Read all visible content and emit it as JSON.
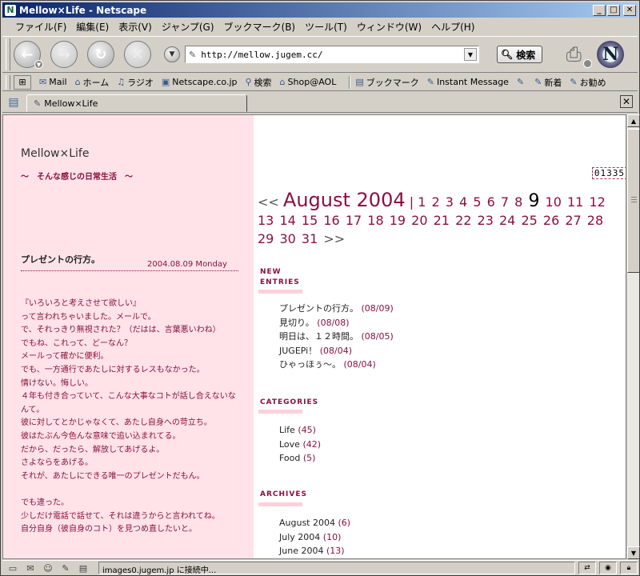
{
  "window": {
    "title": "Mellow×Life - Netscape"
  },
  "menu": [
    "ファイル(F)",
    "編集(E)",
    "表示(V)",
    "ジャンプ(G)",
    "ブックマーク(B)",
    "ツール(T)",
    "ウィンドウ(W)",
    "ヘルプ(H)"
  ],
  "nav": {
    "url": "http://mellow.jugem.cc/",
    "search_label": "検索"
  },
  "personal_bar": [
    {
      "label": "Mail",
      "icon": "mail-icon"
    },
    {
      "label": "ホーム",
      "icon": "home-icon"
    },
    {
      "label": "ラジオ",
      "icon": "headphones-icon"
    },
    {
      "label": "Netscape.co.jp",
      "icon": "my-icon"
    },
    {
      "label": "検索",
      "icon": "search-icon"
    },
    {
      "label": "Shop@AOL",
      "icon": "shop-icon"
    },
    {
      "label": "ブックマーク",
      "icon": "bookmark-icon"
    },
    {
      "label": "Instant Message",
      "icon": "im-icon"
    },
    {
      "label": "",
      "icon": "link-icon"
    },
    {
      "label": "新着",
      "icon": "link-icon"
    },
    {
      "label": "お勧め",
      "icon": "link-icon"
    }
  ],
  "tab": {
    "label": "Mellow×Life"
  },
  "blog": {
    "title": "Mellow×Life",
    "subtitle": "〜　そんな感じの日常生活　〜",
    "counter": "01335"
  },
  "post": {
    "title": "プレゼントの行方。",
    "date": "2004.08.09 Monday",
    "lines": [
      "『いろいろと考えさせて欲しい』",
      "って言われちゃいました。メールで。",
      "で、それっきり無視された？（だはは、言葉悪いわね）",
      "でもね、これって、どーなん？",
      "メールって確かに便利。",
      "でも、一方通行であたしに対するレスもなかった。",
      "情けない。悔しい。",
      "４年も付き合っていて、こんな大事なコトが話し合えないなんて。",
      "彼に対してとかじゃなくて、あたし自身への苛立ち。",
      "彼はたぶん今色んな意味で追い込まれてる。",
      "だから、だったら、解放してあげるよ。",
      "さよならをあげる。",
      "それが、あたしにできる唯一のプレゼントだもん。",
      "",
      "でも違った。",
      "少しだけ電話で話せて、それは違うからと言われてね。",
      "自分自身（彼自身のコト）を見つめ直したいと。"
    ]
  },
  "calendar": {
    "prev": "<<",
    "month": "August 2004",
    "next": ">>",
    "today": "9",
    "days": [
      "1",
      "2",
      "3",
      "4",
      "5",
      "6",
      "7",
      "8",
      "9",
      "10",
      "11",
      "12",
      "13",
      "14",
      "15",
      "16",
      "17",
      "18",
      "19",
      "20",
      "21",
      "22",
      "23",
      "24",
      "25",
      "26",
      "27",
      "28",
      "29",
      "30",
      "31"
    ]
  },
  "sections": {
    "new_entries": {
      "heading_line1": "NEW",
      "heading_line2": "ENTRIES",
      "items": [
        {
          "title": "プレゼントの行方。",
          "date": "(08/09)"
        },
        {
          "title": "見切り。",
          "date": "(08/08)"
        },
        {
          "title": "明日は、１２時間。",
          "date": "(08/05)"
        },
        {
          "title": "JUGEPi！",
          "date": "(08/04)"
        },
        {
          "title": "ひゃっほぅ〜。",
          "date": "(08/04)"
        }
      ]
    },
    "categories": {
      "heading": "CATEGORIES",
      "items": [
        {
          "title": "Life",
          "count": "(45)"
        },
        {
          "title": "Love",
          "count": "(42)"
        },
        {
          "title": "Food",
          "count": "(5)"
        }
      ]
    },
    "archives": {
      "heading": "ARCHIVES",
      "items": [
        {
          "title": "August 2004",
          "count": "(6)"
        },
        {
          "title": "July 2004",
          "count": "(10)"
        },
        {
          "title": "June 2004",
          "count": "(13)"
        }
      ]
    }
  },
  "status": {
    "text": "images0.jugem.jp に接続中..."
  }
}
